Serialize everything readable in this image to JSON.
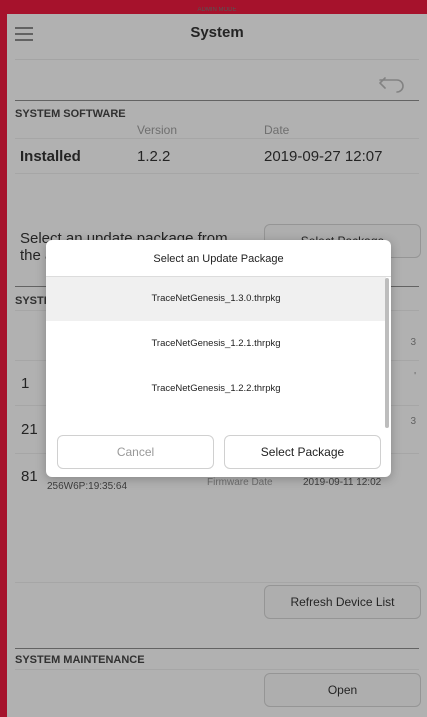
{
  "header": {
    "admin_mode": "ADMIN MODE",
    "title": "System"
  },
  "system_software": {
    "section_title": "SYSTEM SOFTWARE",
    "col_version": "Version",
    "col_date": "Date",
    "installed_label": "Installed",
    "installed_version": "1.2.2",
    "installed_date": "2019-09-27 12:07",
    "select_prompt_line1": "Select an update package from",
    "select_prompt_line2": "the a",
    "select_package_button": "Select Package"
  },
  "system_devices": {
    "section_title_fragment": "SYSTI",
    "row_ids": [
      "1",
      "21",
      "81"
    ],
    "right_fragments": [
      "3",
      "'",
      "3"
    ],
    "serial": "256W6P:19:35:64",
    "firmware_label": "Firmware Date",
    "firmware_date": "2019-09-11 12:02",
    "refresh_button": "Refresh Device List"
  },
  "maintenance": {
    "section_title": "SYSTEM MAINTENANCE",
    "open_button": "Open"
  },
  "dialog": {
    "title": "Select an Update Package",
    "packages": [
      "TraceNetGenesis_1.3.0.thrpkg",
      "TraceNetGenesis_1.2.1.thrpkg",
      "TraceNetGenesis_1.2.2.thrpkg"
    ],
    "cancel_label": "Cancel",
    "select_label": "Select Package"
  },
  "colors": {
    "frame": "#e61a3d",
    "background": "#f5f5f5",
    "selected_row": "#f0f0f0"
  }
}
